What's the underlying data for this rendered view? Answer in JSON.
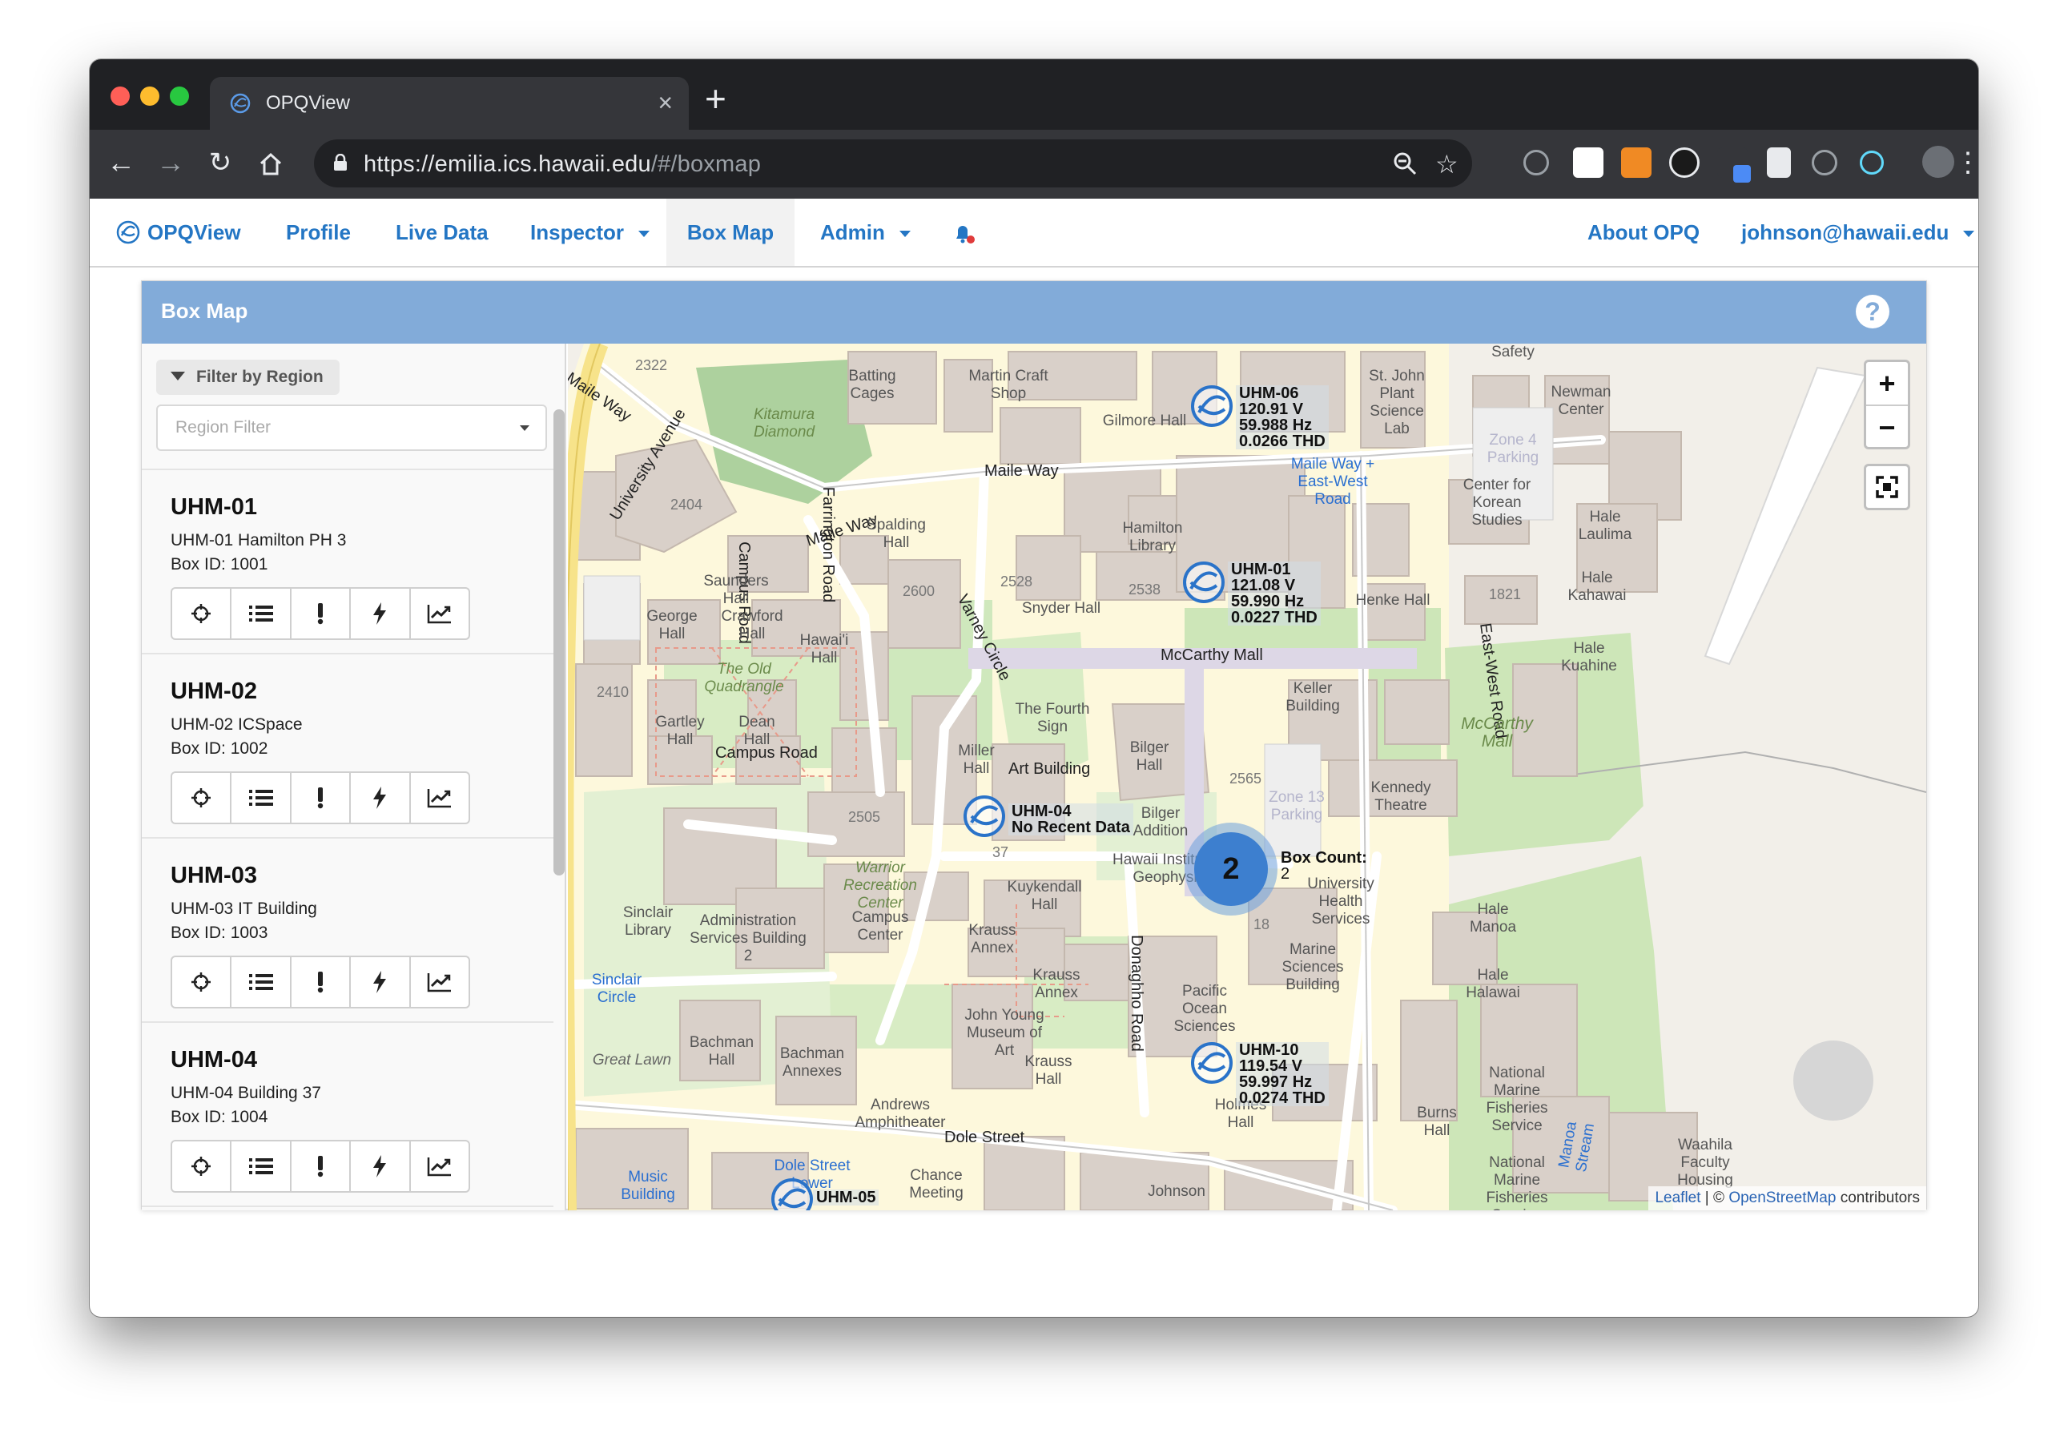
{
  "browser": {
    "tab_title": "OPQView",
    "url_host": "https://emilia.ics.hawaii.edu",
    "url_path": "/#/boxmap"
  },
  "nav": {
    "brand": "OPQView",
    "items": [
      "Profile",
      "Live Data",
      "Inspector",
      "Box Map",
      "Admin"
    ],
    "right_items": [
      "About OPQ",
      "johnson@hawaii.edu"
    ]
  },
  "panel": {
    "title": "Box Map"
  },
  "sidebar": {
    "filter_label": "Filter by Region",
    "region_placeholder": "Region Filter",
    "boxes": [
      {
        "name": "UHM-01",
        "description": "UHM-01 Hamilton PH 3",
        "box_id": "Box ID: 1001"
      },
      {
        "name": "UHM-02",
        "description": "UHM-02 ICSpace",
        "box_id": "Box ID: 1002"
      },
      {
        "name": "UHM-03",
        "description": "UHM-03 IT Building",
        "box_id": "Box ID: 1003"
      },
      {
        "name": "UHM-04",
        "description": "UHM-04 Building 37",
        "box_id": "Box ID: 1004"
      }
    ],
    "actions": [
      "crosshairs-icon",
      "list-icon",
      "exclamation-icon",
      "bolt-icon",
      "chart-line-icon"
    ]
  },
  "map": {
    "markers": [
      {
        "name": "UHM-06",
        "l1": "120.91 V",
        "l2": "59.988 Hz",
        "l3": "0.0266 THD"
      },
      {
        "name": "UHM-01",
        "l1": "121.08 V",
        "l2": "59.990 Hz",
        "l3": "0.0227 THD"
      },
      {
        "name": "UHM-04",
        "l1": "No Recent Data",
        "l2": "",
        "l3": ""
      },
      {
        "name": "UHM-10",
        "l1": "119.54 V",
        "l2": "59.997 Hz",
        "l3": "0.0274 THD"
      },
      {
        "name": "UHM-05",
        "l1": "",
        "l2": "",
        "l3": ""
      }
    ],
    "cluster": {
      "count": "2",
      "label": "Box Count:",
      "value": "2"
    },
    "zoom_in": "+",
    "zoom_out": "−",
    "attribution_leaflet": "Leaflet",
    "attribution_sep": " | © ",
    "attribution_osm": "OpenStreetMap",
    "attribution_tail": " contributors",
    "labels": {
      "maile_way_1": "Maile Way",
      "maile_way_2": "Maile Way",
      "maile_way_3": "Maile Way",
      "university_ave": "University Avenue",
      "farrington": "Farrington Road",
      "campus_road_v": "Campus Road",
      "campus_road": "Campus Road",
      "mccarthy": "McCarthy Mall",
      "east_west": "East-West Road",
      "dole_street": "Dole Street",
      "donaghho": "Donaghho Road",
      "varney": "Varney Circle",
      "batting_cages": "Batting Cages",
      "martin": "Martin Craft Shop",
      "gilmore": "Gilmore Hall",
      "st_john": "St. John Plant Science Lab",
      "safety": "Safety",
      "newman": "Newman Center",
      "kitamura": "Kitamura Diamond",
      "saunders": "Saunders Hall",
      "spalding": "Spalding Hall",
      "hamilton": "Hamilton Library",
      "snyder": "Snyder Hall",
      "henke": "Henke Hall",
      "korean": "Center for Korean Studies",
      "hale_laulima": "Hale Laulima",
      "hale_kahawai": "Hale Kahawai",
      "hale_kuahine": "Hale Kuahine",
      "george": "George Hall",
      "crawford": "Crawford Hall",
      "hawaii_hall": "Hawai'i Hall",
      "old_quad": "The Old Quadrangle",
      "gartley": "Gartley Hall",
      "dean": "Dean Hall",
      "keller": "Keller Building",
      "fourth_sign": "The Fourth Sign",
      "art_building": "Art Building",
      "bilger_hall": "Bilger Hall",
      "miller": "Miller Hall",
      "kennedy": "Kennedy Theatre",
      "mccarthy_mall_green": "McCarthy Mall",
      "sinclair_lib": "Sinclair Library",
      "admin_services": "Administration Services Building 2",
      "warrior": "Warrior Recreation Center",
      "campus_center": "Campus Center",
      "kuykendall": "Kuykendall Hall",
      "krauss_annex": "Krauss Annex",
      "hawaii_inst": "Hawaii Institute of Geophysics",
      "univ_health": "University Health Services",
      "marine_sci": "Marine Sciences Building",
      "hale_manoa": "Hale Manoa",
      "hale_halawai": "Hale Halawai",
      "sinclair_circle": "Sinclair Circle",
      "bachman_hall": "Bachman Hall",
      "bachman_annexes": "Bachman Annexes",
      "john_young": "John Young Museum of Art",
      "krauss_hall": "Krauss Hall",
      "andrews": "Andrews Amphitheater",
      "pacific_ocean": "Pacific Ocean Sciences",
      "holmes": "Holmes Hall",
      "great_lawn": "Great Lawn",
      "nmfs": "National Marine Fisheries Service",
      "burns": "Burns Hall",
      "manoa_stream": "Manoa Stream",
      "waahila": "Waahila Faculty Housing",
      "music": "Music Building",
      "chance": "Chance Meeting",
      "johnson": "Johnson",
      "dole_st_lower": "Dole Street Lower",
      "maile_east_west": "Maile Way + East-West Road",
      "zone_4": "Zone 4 Parking",
      "zone_13": "Zone 13 Parking",
      "n2322": "2322",
      "n2404": "2404",
      "n2410": "2410",
      "n2600": "2600",
      "n2528": "2528",
      "n2538": "2538",
      "n1821": "1821",
      "n2505": "2505",
      "n2565": "2565",
      "n37": "37",
      "n18": "18",
      "bilger_addition": "Bilger Addition"
    }
  }
}
